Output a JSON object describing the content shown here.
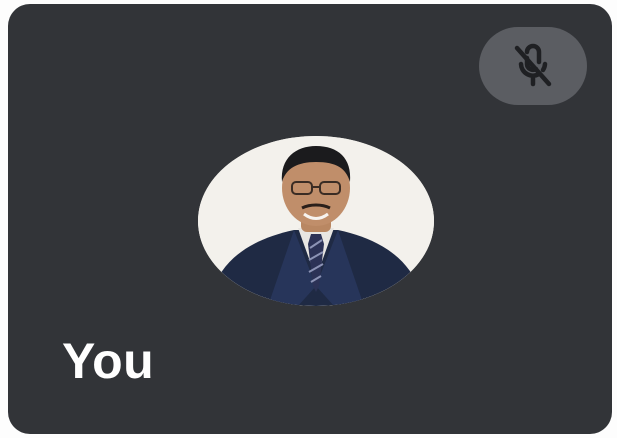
{
  "participant": {
    "name": "You",
    "mic_state_icon": "mic-off-icon",
    "avatar_type": "profile-photo"
  },
  "colors": {
    "tile_background": "#323438",
    "mute_button_background": "#5b5d62",
    "name_text": "#ffffff"
  }
}
